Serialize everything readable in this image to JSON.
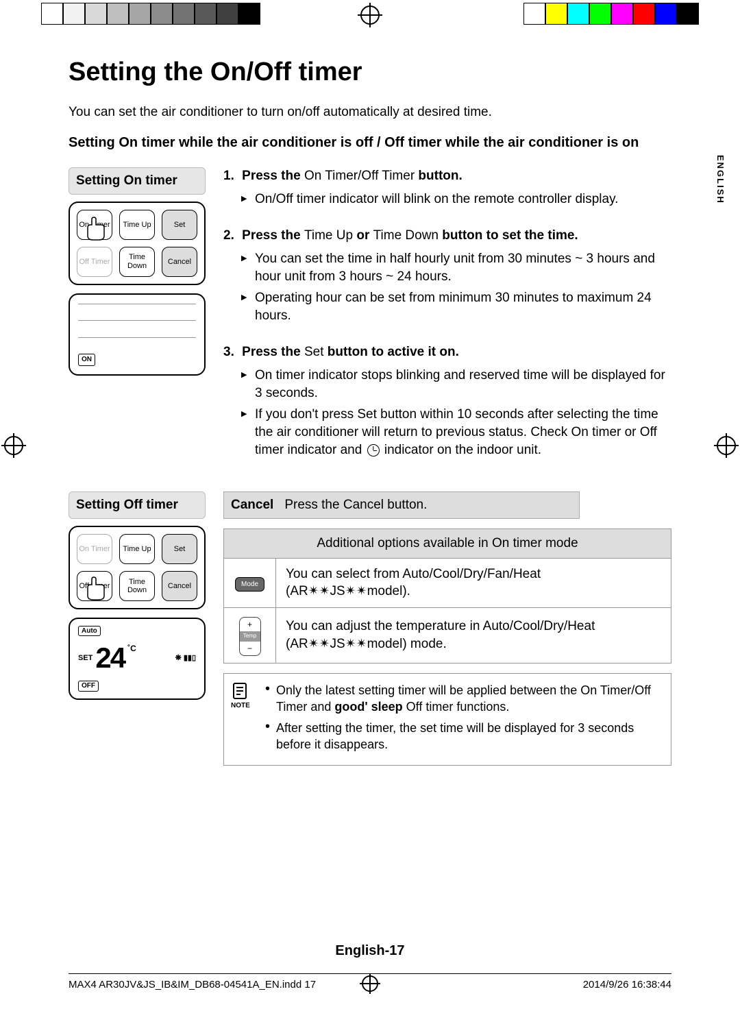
{
  "colorbar_left": [
    "#fff",
    "#f2f2f2",
    "#d9d9d9",
    "#bfbfbf",
    "#a6a6a6",
    "#8c8c8c",
    "#737373",
    "#595959",
    "#404040",
    "#000"
  ],
  "colorbar_right": [
    "#fff",
    "#ff0",
    "#0ff",
    "#0f0",
    "#f0f",
    "#f00",
    "#00f",
    "#000"
  ],
  "title": "Setting the On/Off timer",
  "intro": "You can set the air conditioner to turn on/off automatically at desired time.",
  "subhead": "Setting On timer while the air conditioner is off / Off timer while the air conditioner is on",
  "side_lang": "ENGLISH",
  "on_timer": {
    "box_title": "Setting On timer",
    "buttons": {
      "on_timer": "On Timer",
      "time_up": "Time Up",
      "set": "Set",
      "off_timer": "Off Timer",
      "time_down": "Time Down",
      "cancel": "Cancel"
    },
    "lcd_tag": "ON"
  },
  "off_timer": {
    "box_title": "Setting Off timer",
    "lcd": {
      "auto": "Auto",
      "set": "SET",
      "temp": "24",
      "unit": "˚C",
      "off": "OFF"
    }
  },
  "steps": {
    "s1": {
      "head_bold_a": "Press the ",
      "head_nb": "On Timer/Off Timer",
      "head_bold_b": " button.",
      "b1": "On/Off timer indicator will blink on the remote controller display."
    },
    "s2": {
      "head_bold_a": "Press the ",
      "head_nb_a": "Time Up",
      "head_bold_b": " or ",
      "head_nb_b": "Time Down",
      "head_bold_c": " button to set the time.",
      "b1": "You can set the time in half hourly unit from 30 minutes ~ 3 hours and hour unit from 3 hours ~ 24 hours.",
      "b2": "Operating hour can be set from minimum 30 minutes to maximum 24 hours."
    },
    "s3": {
      "head_bold_a": "Press the ",
      "head_nb": "Set",
      "head_bold_b": " button to active it on.",
      "b1": "On timer indicator stops blinking and reserved time will be displayed for 3 seconds.",
      "b2_a": "If you don't press ",
      "b2_nb": "Set",
      "b2_b": " button within 10 seconds after selecting the time the air conditioner will return to previous status. Check On timer or Off timer indicator and ",
      "b2_c": " indicator on the indoor unit."
    }
  },
  "cancel": {
    "label": "Cancel",
    "text_a": "Press the ",
    "text_nb": "Cancel",
    "text_b": " button."
  },
  "opts": {
    "header": "Additional options available in On timer mode",
    "mode_label": "Mode",
    "mode_text": "You can select from Auto/Cool/Dry/Fan/Heat (AR✴✴JS✴✴model).",
    "temp_label": "Temp",
    "temp_text": "You can adjust the temperature in Auto/Cool/Dry/Heat (AR✴✴JS✴✴model) mode."
  },
  "note": {
    "label": "NOTE",
    "n1_a": "Only the latest setting timer will be applied between the On Timer/Off Timer and ",
    "n1_bold": "good' sleep",
    "n1_b": " Off timer functions.",
    "n2": "After setting the timer, the set time will be displayed for 3 seconds before it disappears."
  },
  "page_foot": "English-17",
  "print_left": "MAX4 AR30JV&JS_IB&IM_DB68-04541A_EN.indd   17",
  "print_right": "2014/9/26   16:38:44"
}
